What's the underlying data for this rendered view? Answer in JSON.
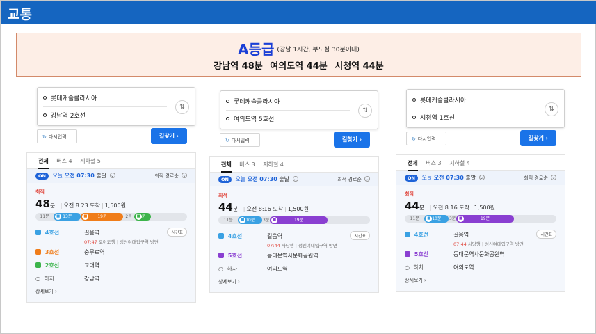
{
  "header": {
    "title": "교통"
  },
  "grade": {
    "title": "A등급",
    "note": "(강남 1시간, 부도심 30분이내)",
    "items": [
      "강남역 48분",
      "여의도역 44분",
      "시청역 44분"
    ]
  },
  "common": {
    "reset_label": "다시입력",
    "find_label": "길찾기",
    "tab_all": "전체",
    "on_badge": "ON",
    "dep_day": "오늘",
    "dep_time": "오전 07:30",
    "dep_label": "출발",
    "sort_label": "최적 경로순",
    "best_label": "최적",
    "min_unit": "분",
    "fare": "1,500원",
    "timetable_label": "시간표",
    "more_label": "상세보기",
    "get_off": "하차",
    "chevron_right": "›",
    "swap_glyph": "⇅"
  },
  "panels": [
    {
      "start": "롯데캐슬클라시아",
      "end": "강남역 2호선",
      "tab_bus": "버스 4",
      "tab_subway": "지하철 5",
      "minutes": "48",
      "arrival": "오전 8:23 도착",
      "segments": [
        {
          "label": "11분",
          "kind": "walk",
          "color": ""
        },
        {
          "label": "13분",
          "kind": "line",
          "color": "#3aa1e3"
        },
        {
          "label": "19분",
          "kind": "line",
          "color": "#f07d1a"
        },
        {
          "label": "2분",
          "kind": "walk",
          "color": ""
        },
        {
          "label": "2분",
          "kind": "line",
          "color": "#3cb44b"
        }
      ],
      "steps": [
        {
          "line": "4호선",
          "color": "#3aa1e3",
          "station": "길음역",
          "timetable": true,
          "sub_time": "07:47",
          "sub_dir": "오이도행",
          "sub_next": "성신여대입구역 방면"
        },
        {
          "line": "3호선",
          "color": "#f07d1a",
          "station": "충무로역",
          "timetable": false
        },
        {
          "line": "2호선",
          "color": "#3cb44b",
          "station": "교대역",
          "timetable": false
        },
        {
          "line": "하차",
          "color": "",
          "station": "강남역",
          "timetable": false
        }
      ]
    },
    {
      "start": "롯데캐슬클라시아",
      "end": "여의도역 5호선",
      "tab_bus": "버스 3",
      "tab_subway": "지하철 4",
      "minutes": "44",
      "arrival": "오전 8:16 도착",
      "segments": [
        {
          "label": "11분",
          "kind": "walk",
          "color": ""
        },
        {
          "label": "10분",
          "kind": "line",
          "color": "#3aa1e3"
        },
        {
          "label": "3분",
          "kind": "walk",
          "color": ""
        },
        {
          "label": "19분",
          "kind": "line",
          "color": "#8a3fd1"
        }
      ],
      "steps": [
        {
          "line": "4호선",
          "color": "#3aa1e3",
          "station": "길음역",
          "timetable": true,
          "sub_time": "07:44",
          "sub_dir": "사당행",
          "sub_next": "성신여대입구역 방면"
        },
        {
          "line": "5호선",
          "color": "#8a3fd1",
          "station": "동대문역사문화공원역",
          "timetable": false
        },
        {
          "line": "하차",
          "color": "",
          "station": "여의도역",
          "timetable": false
        }
      ]
    },
    {
      "start": "롯데캐슬클라시아",
      "end": "시청역 1호선",
      "tab_bus": "버스 3",
      "tab_subway": "지하철 4",
      "minutes": "44",
      "arrival": "오전 8:16 도착",
      "segments": [
        {
          "label": "11분",
          "kind": "walk",
          "color": ""
        },
        {
          "label": "10분",
          "kind": "line",
          "color": "#3aa1e3"
        },
        {
          "label": "3분",
          "kind": "walk",
          "color": ""
        },
        {
          "label": "19분",
          "kind": "line",
          "color": "#8a3fd1"
        }
      ],
      "steps": [
        {
          "line": "4호선",
          "color": "#3aa1e3",
          "station": "길음역",
          "timetable": true,
          "sub_time": "07:44",
          "sub_dir": "사당행",
          "sub_next": "성신여대입구역 방면"
        },
        {
          "line": "5호선",
          "color": "#8a3fd1",
          "station": "동대문역사문화공원역",
          "timetable": false
        },
        {
          "line": "하차",
          "color": "",
          "station": "여의도역",
          "timetable": false
        }
      ]
    }
  ]
}
